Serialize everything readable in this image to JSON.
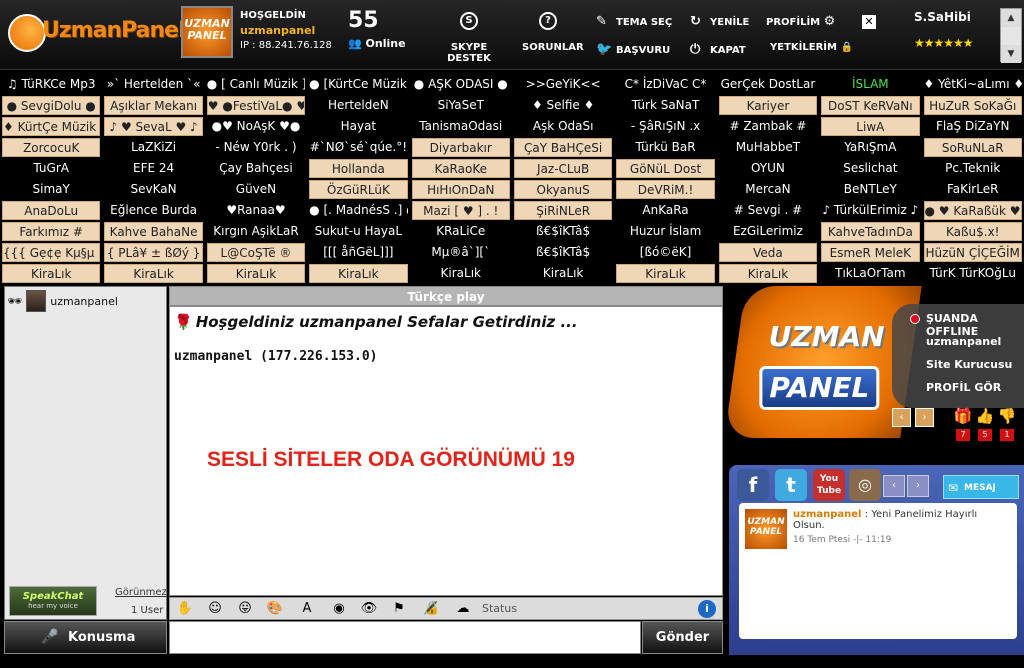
{
  "header": {
    "logo_text": "UzmanPaneL",
    "badge_text": "UZMAN PANEL",
    "greeting": "HOŞGELDİN",
    "username": "uzmanpanel",
    "ip": "IP : 88.241.76.128",
    "online_count": "55",
    "online_label": "Online",
    "skype_label": "SKYPE DESTEK",
    "sorunlar_label": "SORUNLAR",
    "tema_label": "TEMA SEÇ",
    "basvuru_label": "BAŞVURU",
    "yenile_label": "YENİLE",
    "kapat_label": "KAPAT",
    "profilim_label": "PROFİLİM",
    "yetkilerim_label": "YETKİLERİM",
    "owner": "S.SaHibi",
    "stars": "★★★★★★"
  },
  "rooms": [
    [
      "♫ TüRKCe Mp3",
      "d"
    ],
    [
      "»` Hertelden `«",
      "d"
    ],
    [
      "● [ Canlı Müzik ]",
      "d"
    ],
    [
      "● [KürtCe Müzik]",
      "d"
    ],
    [
      "● AŞK ODASI ●",
      "d"
    ],
    [
      ">>GeYiK<<",
      "d"
    ],
    [
      "C* İzDiVaC C*",
      "d"
    ],
    [
      "GerÇek DostLar",
      "d"
    ],
    [
      "İSLAM",
      "g"
    ],
    [
      "♦ YêtKi~aLımı ♦",
      "d"
    ],
    [
      "● SevgiDolu ●",
      "t"
    ],
    [
      "Aşıklar Mekanı",
      "t"
    ],
    [
      "♥ ●FestiVaL● ♥",
      "t"
    ],
    [
      "HerteldeN",
      "d"
    ],
    [
      "SiYaSeT",
      "d"
    ],
    [
      "♦ Selfie ♦",
      "d"
    ],
    [
      "Türk SaNaT",
      "d"
    ],
    [
      "Kariyer",
      "t"
    ],
    [
      "DoST KeRVaNı",
      "t"
    ],
    [
      "HuZuR SoKaĞı",
      "t"
    ],
    [
      "♦ KürtÇe Müzik ♦",
      "t"
    ],
    [
      "♪ ♥ SevaL ♥ ♪",
      "t"
    ],
    [
      "●♥ NoAşK ♥●",
      "d"
    ],
    [
      "Hayat",
      "d"
    ],
    [
      "TanismaOdasi",
      "d"
    ],
    [
      "Aşk OdaSı",
      "d"
    ],
    [
      "- ŞâRıŞıN .x",
      "d"
    ],
    [
      "# Zambak #",
      "d"
    ],
    [
      "LiwA",
      "t"
    ],
    [
      "FlaŞ DiZaYN",
      "d"
    ],
    [
      "ZorcocuK",
      "t"
    ],
    [
      "LaZKiZi",
      "d"
    ],
    [
      "- Néw Y0rk . )",
      "d"
    ],
    [
      "#`NØ`sé`qúe.°!",
      "d"
    ],
    [
      "Diyarbakır",
      "t"
    ],
    [
      "ÇaY BaHÇeSi",
      "t"
    ],
    [
      "Türkü BaR",
      "d"
    ],
    [
      "MuHabbeT",
      "d"
    ],
    [
      "YaRıŞmA",
      "d"
    ],
    [
      "SoRuNLaR",
      "t"
    ],
    [
      "TuGrA",
      "d"
    ],
    [
      "EFE  24",
      "d"
    ],
    [
      "Çay Bahçesi",
      "d"
    ],
    [
      "Hollanda",
      "t"
    ],
    [
      "KaRaoKe",
      "t"
    ],
    [
      "Jaz-CLuB",
      "t"
    ],
    [
      "GöNüL Dost",
      "t"
    ],
    [
      "OYUN",
      "d"
    ],
    [
      "Seslichat",
      "d"
    ],
    [
      "Pc.Teknik",
      "d"
    ],
    [
      "SimaY",
      "d"
    ],
    [
      "SevKaN",
      "d"
    ],
    [
      "GüveN",
      "d"
    ],
    [
      "ÖzGüRLüK",
      "t"
    ],
    [
      "HıHıOnDaN",
      "t"
    ],
    [
      "OkyanuS",
      "t"
    ],
    [
      "DeVRiM.!",
      "t"
    ],
    [
      "MercaN",
      "d"
    ],
    [
      "BeNTLeY",
      "d"
    ],
    [
      "FaKirLeR",
      "d"
    ],
    [
      "AnaDoLu",
      "t"
    ],
    [
      "Eğlence Burda",
      "d"
    ],
    [
      "♥Ranaa♥",
      "d"
    ],
    [
      "● [. MadnésS .] ●",
      "d"
    ],
    [
      "Mazi [ ♥ ] . !",
      "t"
    ],
    [
      "ŞiRiNLeR",
      "t"
    ],
    [
      "AnKaRa",
      "d"
    ],
    [
      "# Sevgi . #",
      "d"
    ],
    [
      "♪ TürkülErimiz ♪",
      "d"
    ],
    [
      "● ♥ KaRaßük ♥ ●",
      "t"
    ],
    [
      "Farkımız #",
      "t"
    ],
    [
      "Kahve BahaNe",
      "t"
    ],
    [
      "Kırgın AşikLaR",
      "d"
    ],
    [
      "Sukut-u HayaL",
      "d"
    ],
    [
      "KRaLiCe",
      "d"
    ],
    [
      "ß€$îKTâ$",
      "d"
    ],
    [
      "Huzur İslam",
      "d"
    ],
    [
      "EzGiLerimiz",
      "d"
    ],
    [
      "KahveTadınDa",
      "t"
    ],
    [
      "Kaßu$.x!",
      "t"
    ],
    [
      "{{{ Gẹ¢ẹ Kµ§µ }}}",
      "t"
    ],
    [
      "{ PLâ¥ ± ßØý }",
      "t"
    ],
    [
      "L@CoŞTë    ®",
      "t"
    ],
    [
      "[[[ åñGëL]]]",
      "d"
    ],
    [
      "Mµ®â`][`",
      "d"
    ],
    [
      "ß€$îKTâ$",
      "d"
    ],
    [
      "[ßó©ëK]",
      "d"
    ],
    [
      "Veda",
      "t"
    ],
    [
      "EsmeR MeleK",
      "t"
    ],
    [
      "HüzüN ÇİÇEĞİM",
      "t"
    ],
    [
      "KiraLık",
      "t"
    ],
    [
      "KiraLık",
      "t"
    ],
    [
      "KiraLık",
      "t"
    ],
    [
      "KiraLık",
      "t"
    ],
    [
      "KiraLık",
      "d"
    ],
    [
      "KiraLık",
      "d"
    ],
    [
      "KiraLık",
      "t"
    ],
    [
      "KiraLık",
      "t"
    ],
    [
      "TıkLaOrTam",
      "d"
    ],
    [
      "TürK TürKOğLu",
      "d"
    ]
  ],
  "userlist": {
    "user": "uzmanpanel",
    "speakchat_label": "SpeakChat",
    "speakchat_sub": "hear my voice",
    "gorunmez_label": "Görünmez",
    "user_count": "1 User",
    "konusma_label": "Konusma"
  },
  "chat": {
    "room_title": "Türkçe play",
    "welcome": "Hoşgeldiniz uzmanpanel Sefalar Getirdiniz ...",
    "ip_line": "uzmanpanel (177.226.153.0)",
    "overlay": "SESLİ SİTELER ODA GÖRÜNÜMÜ 19",
    "status_label": "Status",
    "send_label": "Gönder"
  },
  "banner": {
    "logo_top": "UZMAN",
    "logo_bottom": "PANEL",
    "status": "ŞUANDA OFFLINE",
    "name": "uzmanpanel",
    "role": "Site Kurucusu",
    "profile_link": "PROFİL GÖR",
    "gift_count": "7",
    "like_count": "5",
    "dislike_count": "1"
  },
  "social": {
    "fb": "f",
    "tw": "t",
    "yt": "You Tube",
    "mesaj_label": "MESAJ YAZ",
    "wall_avatar": "UZMAN PANEL",
    "wall_user": "uzmanpanel",
    "wall_text": " : Yeni Panelimiz Hayırlı Olsun.",
    "wall_time": "16 Tem Ptesi -|- 11:19"
  }
}
